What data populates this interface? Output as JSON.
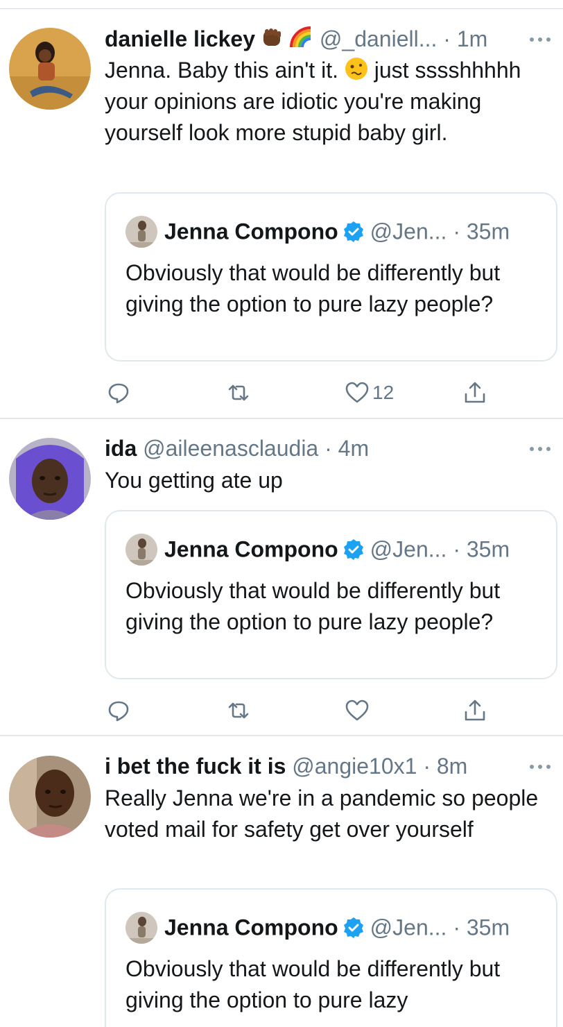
{
  "tweets": [
    {
      "name": "danielle lickey",
      "name_emojis": [
        "raised-fist-dark-skin",
        "rainbow"
      ],
      "handle": "@_daniell...",
      "time": "1m",
      "text_before_emoji": "Jenna. Baby this ain't it. ",
      "inline_emoji": "woozy-face",
      "text_after_emoji": " just sssshhhhh your opinions are idiotic you're making yourself look more stupid baby girl.",
      "text": "Jenna. Baby this ain't it. 🥴 just sssshhhhh your opinions are idiotic you're making yourself look more stupid baby girl.",
      "quoted": {
        "name": "Jenna Compono",
        "verified": true,
        "handle": "@Jen...",
        "time": "35m",
        "text": "Obviously that would be differently but giving the option to pure lazy people?"
      },
      "likes": "12"
    },
    {
      "name": "ida",
      "handle": "@aileenasclaudia",
      "time": "4m",
      "text": "You getting ate up",
      "quoted": {
        "name": "Jenna Compono",
        "verified": true,
        "handle": "@Jen...",
        "time": "35m",
        "text": "Obviously that would be differently but giving the option to pure lazy people?"
      },
      "likes": ""
    },
    {
      "name": "i bet the fuck it is",
      "handle": "@angie10x1",
      "time": "8m",
      "text": "Really Jenna we're in a pandemic so people voted mail for safety get over yourself",
      "quoted": {
        "name": "Jenna Compono",
        "verified": true,
        "handle": "@Jen...",
        "time": "35m",
        "text": "Obviously that would be differently but giving the option to pure lazy"
      }
    }
  ],
  "colors": {
    "text": "#14171a",
    "secondary": "#657786",
    "verified": "#1da1f2",
    "border": "#e1e8ed"
  },
  "icons": [
    "reply-icon",
    "retweet-icon",
    "like-icon",
    "share-icon",
    "more-icon",
    "verified-badge-icon"
  ]
}
